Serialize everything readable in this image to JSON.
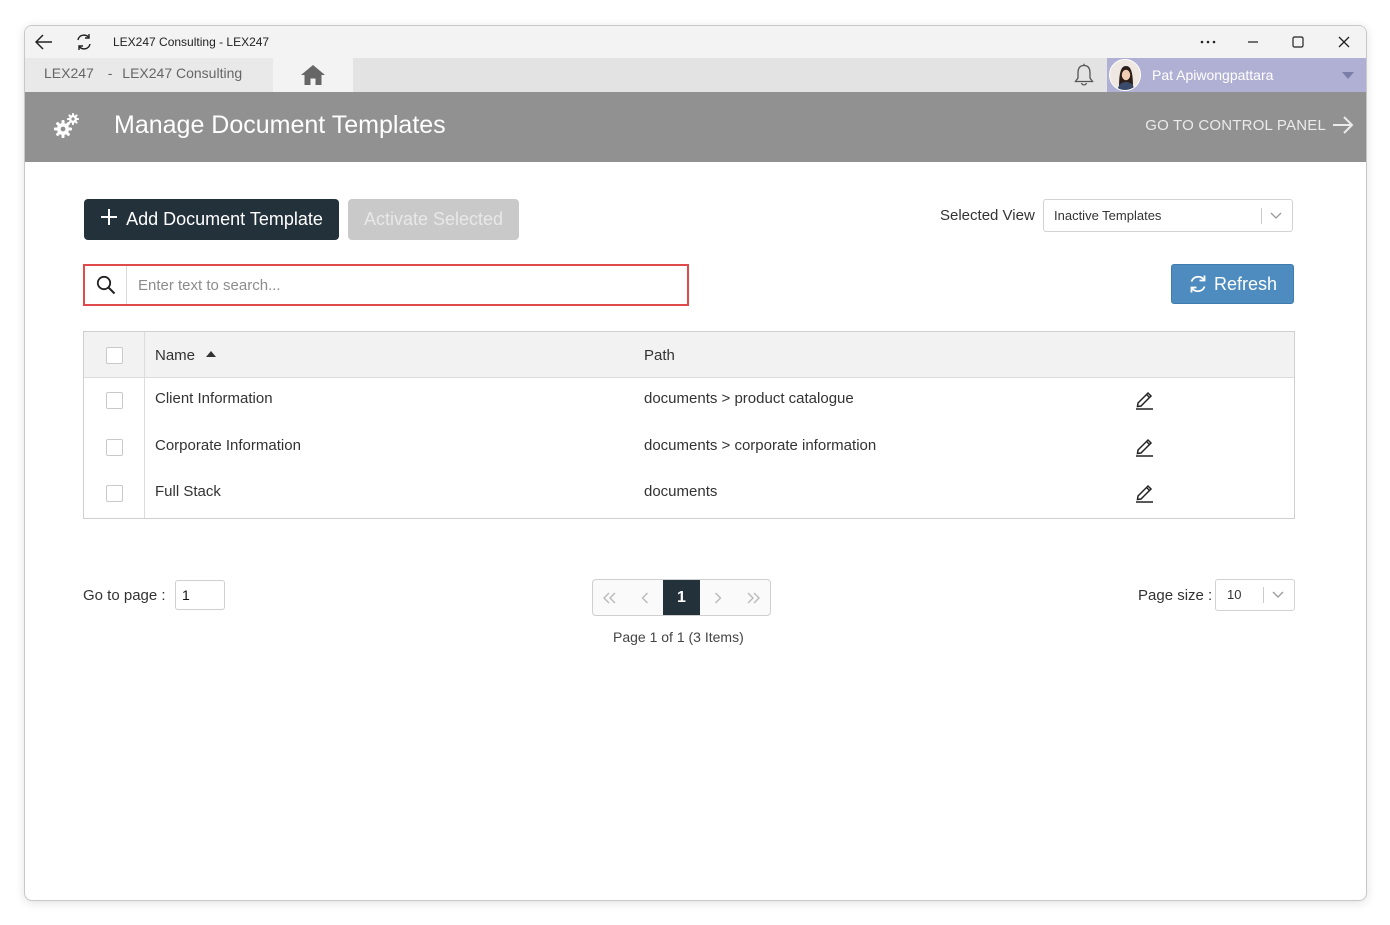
{
  "window": {
    "title": "LEX247 Consulting - LEX247"
  },
  "appbar": {
    "breadcrumb": [
      "LEX247",
      "-",
      "LEX247 Consulting"
    ],
    "user_name": "Pat Apiwongpattara"
  },
  "header": {
    "title": "Manage Document Templates",
    "control_panel_label": "GO TO CONTROL PANEL"
  },
  "toolbar": {
    "add_label": "Add Document Template",
    "activate_label": "Activate Selected",
    "selected_view_label": "Selected View",
    "selected_view_value": "Inactive Templates",
    "search_placeholder": "Enter text to search...",
    "refresh_label": "Refresh"
  },
  "grid": {
    "columns": {
      "name": "Name",
      "path": "Path"
    },
    "rows": [
      {
        "name": "Client Information",
        "path": "documents > product catalogue"
      },
      {
        "name": "Corporate Information",
        "path": "documents > corporate information"
      },
      {
        "name": "Full Stack",
        "path": "documents"
      }
    ]
  },
  "pagination": {
    "goto_label": "Go to page :",
    "goto_value": "1",
    "current_page": "1",
    "info": "Page 1 of 1 (3 Items)",
    "page_size_label": "Page size :",
    "page_size_value": "10"
  },
  "colors": {
    "header_bg": "#919191",
    "primary_dark": "#23313b",
    "refresh_blue": "#4e8cbf",
    "user_area": "#b0b0d4",
    "search_border": "#e14a4a"
  }
}
